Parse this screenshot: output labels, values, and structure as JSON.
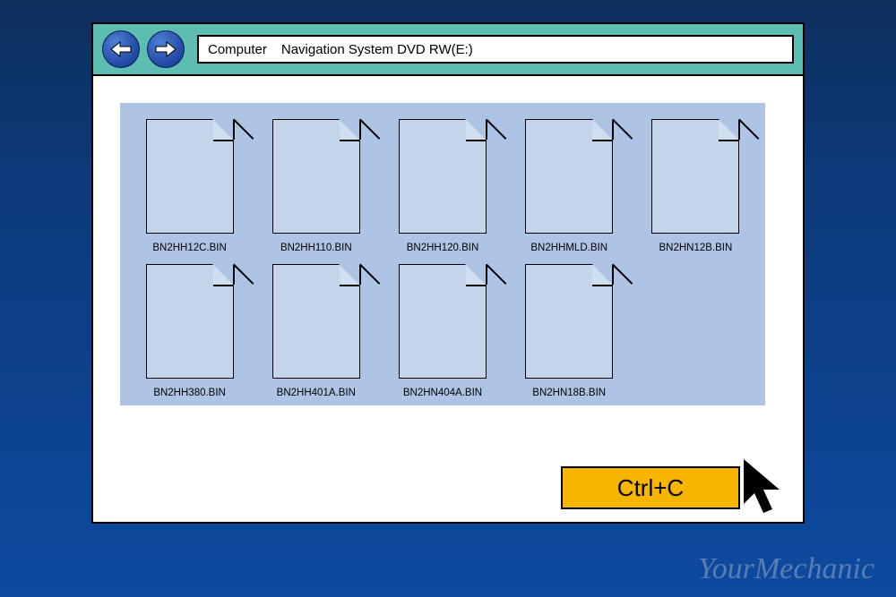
{
  "address": {
    "segment1": "Computer",
    "segment2": "Navigation System DVD RW(E:)"
  },
  "files": [
    "BN2HH12C.BIN",
    "BN2HH110.BIN",
    "BN2HH120.BIN",
    "BN2HHMLD.BIN",
    "BN2HN12B.BIN",
    "BN2HH380.BIN",
    "BN2HH401A.BIN",
    "BN2HN404A.BIN",
    "BN2HN18B.BIN"
  ],
  "shortcut_label": "Ctrl+C",
  "watermark": "YourMechanic",
  "colors": {
    "titlebar": "#5dbdb0",
    "selection": "#aec4e4",
    "fileicon": "#c4d4ea",
    "ctrlc": "#f7b500"
  }
}
